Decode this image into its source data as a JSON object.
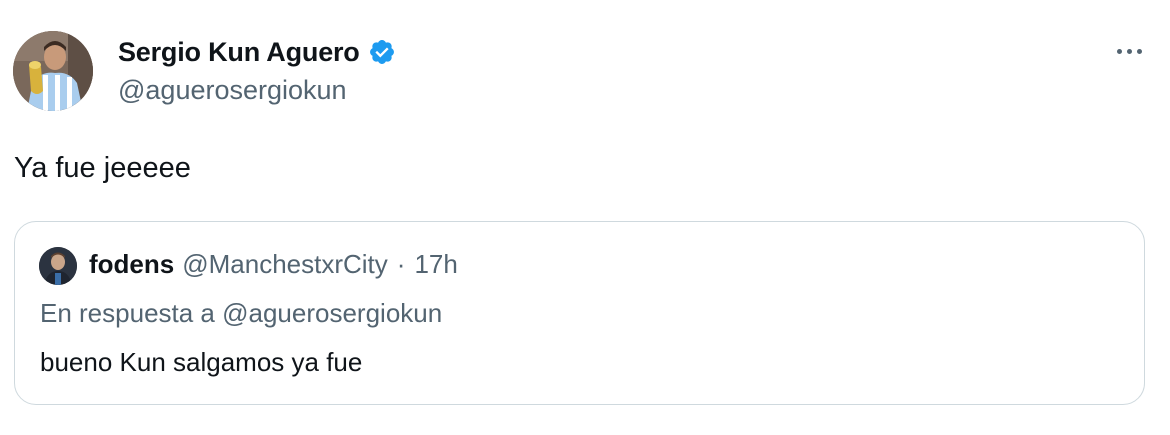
{
  "tweet": {
    "author": {
      "display_name": "Sergio Kun Aguero",
      "handle": "@aguerosergiokun",
      "verified": true,
      "avatar_icon": "profile-photo"
    },
    "text": "Ya fue jeeeee",
    "more_icon": "more-horizontal-icon"
  },
  "quoted_tweet": {
    "author": {
      "display_name": "fodens",
      "handle": "@ManchestxrCity",
      "avatar_icon": "profile-photo"
    },
    "separator": "·",
    "time": "17h",
    "reply_context": "En respuesta a @aguerosergiokun",
    "text": "bueno Kun salgamos ya fue"
  },
  "colors": {
    "primary_text": "#0f1419",
    "secondary_text": "#536471",
    "verified_blue": "#1d9bf0",
    "border": "#cfd9de",
    "background": "#ffffff"
  }
}
